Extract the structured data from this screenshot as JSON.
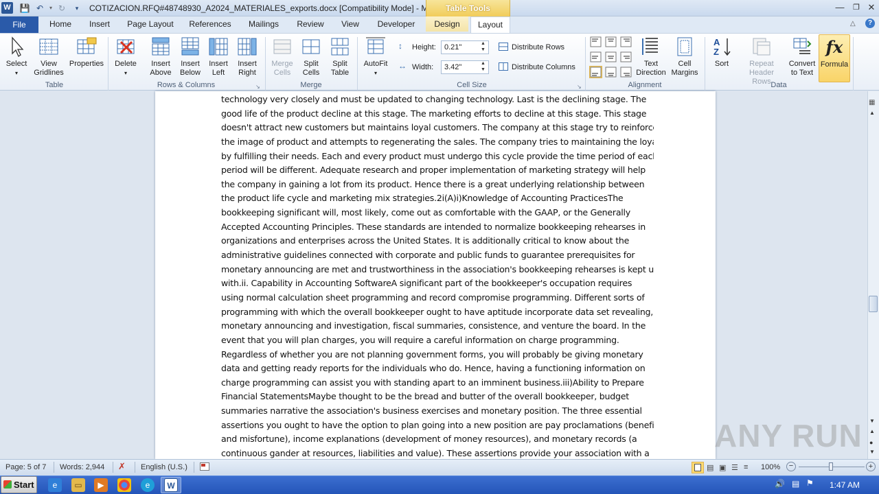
{
  "window": {
    "title": "COTIZACION.RFQ#48748930_A2024_MATERIALES_exports.docx [Compatibility Mode] - Micr...",
    "context_tab": "Table Tools"
  },
  "tabs": [
    "File",
    "Home",
    "Insert",
    "Page Layout",
    "References",
    "Mailings",
    "Review",
    "View",
    "Developer",
    "Design",
    "Layout"
  ],
  "active_tab": "Layout",
  "ribbon": {
    "table": {
      "label": "Table",
      "select": "Select",
      "view_gridlines": "View Gridlines",
      "properties": "Properties"
    },
    "rows_columns": {
      "label": "Rows & Columns",
      "delete": "Delete",
      "insert_above": "Insert Above",
      "insert_below": "Insert Below",
      "insert_left": "Insert Left",
      "insert_right": "Insert Right"
    },
    "merge": {
      "label": "Merge",
      "merge_cells": "Merge Cells",
      "split_cells": "Split Cells",
      "split_table": "Split Table"
    },
    "cell_size": {
      "label": "Cell Size",
      "autofit": "AutoFit",
      "height_label": "Height:",
      "height_value": "0.21\"",
      "width_label": "Width:",
      "width_value": "3.42\"",
      "distribute_rows": "Distribute Rows",
      "distribute_columns": "Distribute Columns"
    },
    "alignment": {
      "label": "Alignment",
      "text_direction": "Text Direction",
      "cell_margins": "Cell Margins"
    },
    "data": {
      "label": "Data",
      "sort": "Sort",
      "repeat_header_rows": "Repeat Header Rows",
      "convert_to_text": "Convert to Text",
      "formula": "Formula"
    }
  },
  "document_lines": [
    "technology very closely and must be updated to changing technology. Last is the declining stage. The",
    "good life of the product decline at this stage. The marketing efforts to decline at this stage. This stage",
    "doesn't attract new customers but maintains loyal customers. The company at this stage try to reinforce",
    "the image of product and attempts to regenerating the sales. The company tries to maintaining the loyal",
    "by fulfilling their needs. Each and every product must undergo this cycle provide the time period of each",
    "period will be different. Adequate research and proper implementation of marketing strategy will help",
    "the company in gaining a lot from its product. Hence there is a great underlying relationship between",
    "the product life cycle and marketing mix strategies.2i(A)i)Knowledge of Accounting PracticesThe",
    "bookkeeping significant will, most likely, come out as comfortable with the GAAP, or the Generally",
    "Accepted Accounting Principles. These standards are intended to normalize bookkeeping rehearses in",
    "organizations and enterprises across the United States. It is additionally critical to know about the",
    "administrative guidelines connected with corporate and public funds to guarantee prerequisites for",
    "monetary announcing are met and trustworthiness in the association's bookkeeping rehearses is kept up",
    "with.ii. Capability in Accounting SoftwareA significant part of the bookkeeper's occupation requires",
    "using normal calculation sheet programming and record compromise programming. Different sorts of",
    "programming with which the overall bookkeeper ought to have aptitude incorporate data set revealing,",
    "monetary announcing and investigation, fiscal summaries, consistence, and venture the board. In the",
    "event that you will plan charges, you will require a careful information on charge programming.",
    "Regardless of whether you are not planning government forms, you will probably be giving monetary",
    "data and getting ready reports for the individuals who do. Hence, having a functioning information on",
    "charge programming can assist you with standing apart to an imminent business.iii)Ability to Prepare",
    "Financial StatementsMaybe thought to be the bread and butter of the overall bookkeeper, budget",
    "summaries narrative the association's business exercises and monetary position. The three essential",
    "assertions you ought to have the option to plan going into a new position are pay proclamations (benefit",
    "and misfortune), income explanations (development of money resources), and monetary records (a",
    "continuous gander at resources, liabilities and value). These assertions provide your association with a"
  ],
  "status": {
    "page": "Page: 5 of 7",
    "words": "Words: 2,944",
    "language": "English (U.S.)",
    "zoom": "100%"
  },
  "taskbar": {
    "start": "Start",
    "time": "1:47 AM"
  },
  "watermark": "ANY RUN"
}
